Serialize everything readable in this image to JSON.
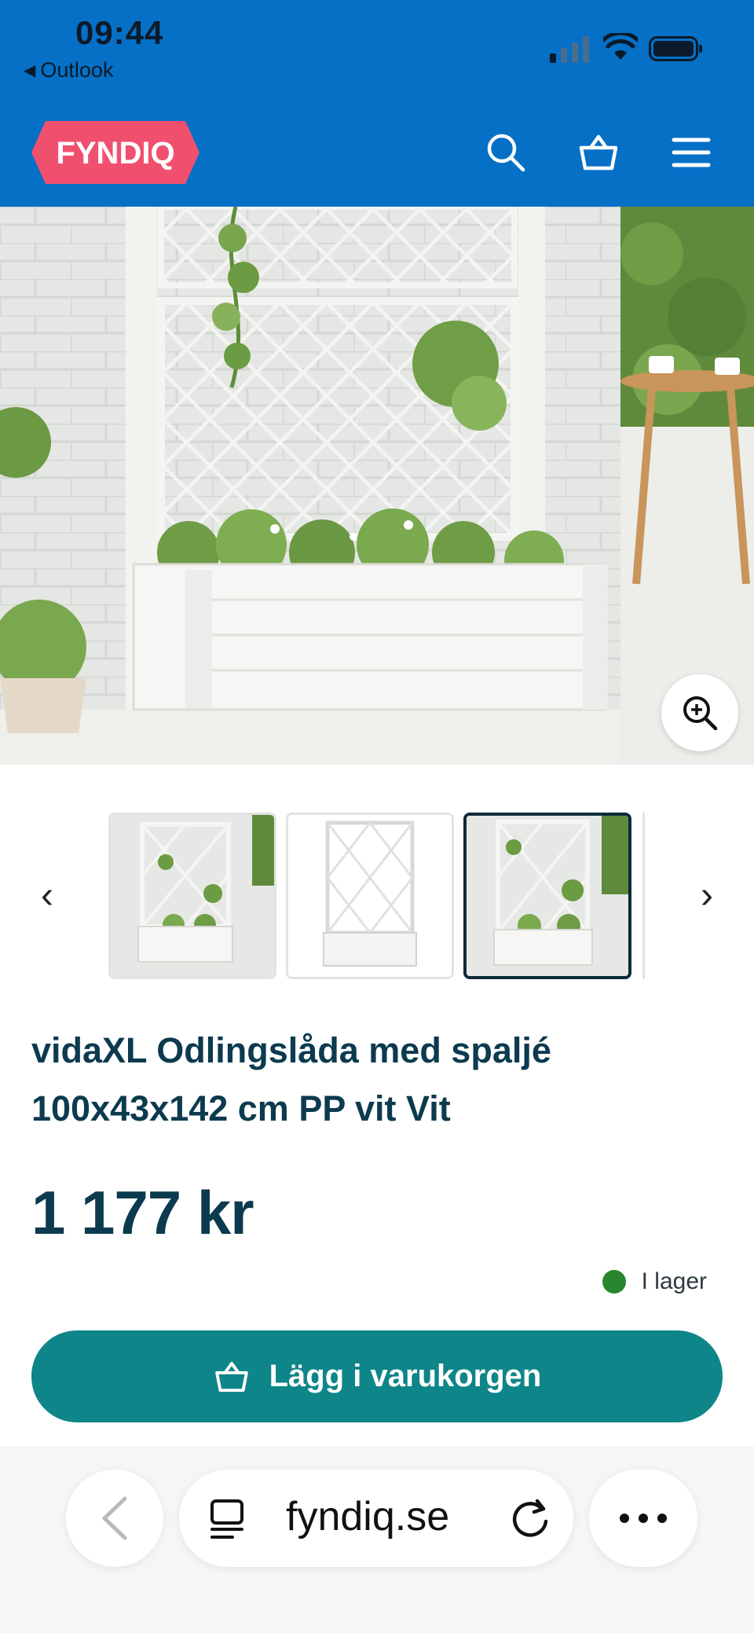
{
  "status_bar": {
    "time": "09:44",
    "back_app": "Outlook"
  },
  "header": {
    "logo_text": "FYNDIQ",
    "icons": [
      "search-icon",
      "cart-icon",
      "menu-icon"
    ],
    "colors": {
      "background": "#0570c6",
      "logo": "#f0506e"
    }
  },
  "gallery": {
    "zoom_icon": "zoom-in-icon",
    "prev_icon": "chevron-left-icon",
    "next_icon": "chevron-right-icon",
    "selected_index": 2
  },
  "product": {
    "title": "vidaXL Odlingslåda med spaljé 100x43x142 cm PP vit Vit",
    "price": "1 177 kr",
    "stock": "I lager",
    "stock_color": "#27862e",
    "add_to_cart": "Lägg i varukorgen",
    "button_color": "#0e8588"
  },
  "browser": {
    "domain": "fyndiq.se",
    "icons": [
      "back-icon",
      "tabs-icon",
      "reload-icon",
      "more-icon"
    ]
  }
}
